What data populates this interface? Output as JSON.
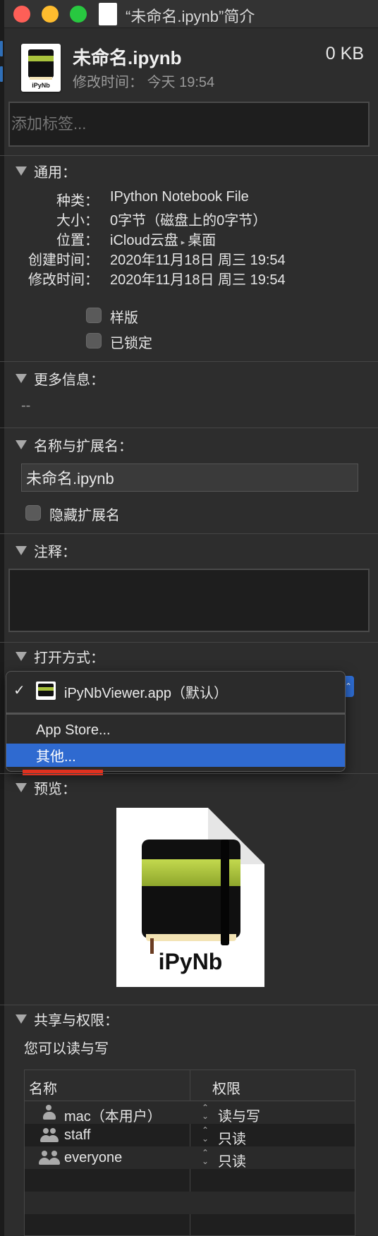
{
  "window": {
    "title": "“未命名.ipynb”简介"
  },
  "header": {
    "file_name": "未命名.ipynb",
    "file_size": "0 KB",
    "modified_label": "修改时间：",
    "modified_value": "今天 19:54",
    "icon_label": "iPyNb"
  },
  "tags": {
    "placeholder": "添加标签..."
  },
  "general": {
    "title": "通用：",
    "rows": [
      {
        "label": "种类：",
        "value": "IPython Notebook File"
      },
      {
        "label": "大小：",
        "value": "0字节（磁盘上的0字节）"
      },
      {
        "label": "位置：",
        "value_a": "iCloud云盘",
        "value_b": "桌面"
      },
      {
        "label": "创建时间：",
        "value": "2020年11月18日 周三 19:54"
      },
      {
        "label": "修改时间：",
        "value": "2020年11月18日 周三 19:54"
      }
    ],
    "stationery_label": "样版",
    "locked_label": "已锁定"
  },
  "more_info": {
    "title": "更多信息：",
    "value": "--"
  },
  "name_ext": {
    "title": "名称与扩展名：",
    "value": "未命名.ipynb",
    "hide_ext_label": "隐藏扩展名"
  },
  "comments": {
    "title": "注释："
  },
  "open_with": {
    "title": "打开方式：",
    "menu": {
      "default_app": "iPyNbViewer.app（默认）",
      "app_store": "App Store...",
      "other": "其他..."
    }
  },
  "preview": {
    "title": "预览：",
    "label": "iPyNb"
  },
  "sharing": {
    "title": "共享与权限：",
    "note": "您可以读与写",
    "columns": [
      "名称",
      "权限"
    ],
    "rows": [
      {
        "name": "mac（本用户）",
        "privilege": "读与写"
      },
      {
        "name": "staff",
        "privilege": "只读"
      },
      {
        "name": "everyone",
        "privilege": "只读"
      }
    ]
  }
}
